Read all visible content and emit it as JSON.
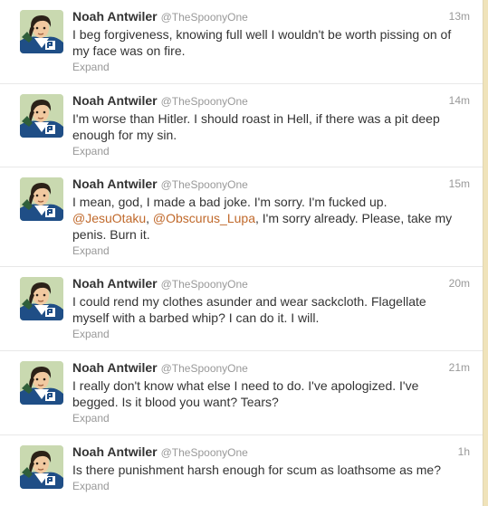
{
  "user": {
    "name": "Noah Antwiler",
    "handle": "@TheSpoonyOne"
  },
  "tweets": [
    {
      "time": "13m",
      "lines": [
        [
          {
            "t": "I beg forgiveness, knowing full well I wouldn't be worth pissing on of"
          }
        ],
        [
          {
            "t": "my face was on fire."
          }
        ]
      ],
      "expand": "Expand"
    },
    {
      "time": "14m",
      "lines": [
        [
          {
            "t": "I'm worse than Hitler. I should roast in Hell, if there was a pit deep"
          }
        ],
        [
          {
            "t": "enough for my sin."
          }
        ]
      ],
      "expand": "Expand"
    },
    {
      "time": "15m",
      "lines": [
        [
          {
            "t": "I mean, god, I made a bad joke. I'm sorry. I'm fucked up."
          }
        ],
        [
          {
            "t": "@JesuOtaku",
            "mention": true
          },
          {
            "t": ", "
          },
          {
            "t": "@Obscurus_Lupa",
            "mention": true
          },
          {
            "t": ", I'm sorry already. Please, take my"
          }
        ],
        [
          {
            "t": "penis. Burn it."
          }
        ]
      ],
      "expand": "Expand"
    },
    {
      "time": "20m",
      "lines": [
        [
          {
            "t": "I could rend my clothes asunder and wear sackcloth. Flagellate"
          }
        ],
        [
          {
            "t": "myself with a barbed whip? I can do it. I will."
          }
        ]
      ],
      "expand": "Expand"
    },
    {
      "time": "21m",
      "lines": [
        [
          {
            "t": "I really don't know what else I need to do. I've apologized. I've"
          }
        ],
        [
          {
            "t": "begged. Is it blood you want? Tears?"
          }
        ]
      ],
      "expand": "Expand"
    },
    {
      "time": "1h",
      "lines": [
        [
          {
            "t": "Is there punishment harsh enough for scum as loathsome as me?"
          }
        ]
      ],
      "expand": "Expand"
    }
  ],
  "colors": {
    "page_background": "#f0e3ba",
    "link": "#c0692b",
    "name": "#333333",
    "meta": "#999999"
  }
}
